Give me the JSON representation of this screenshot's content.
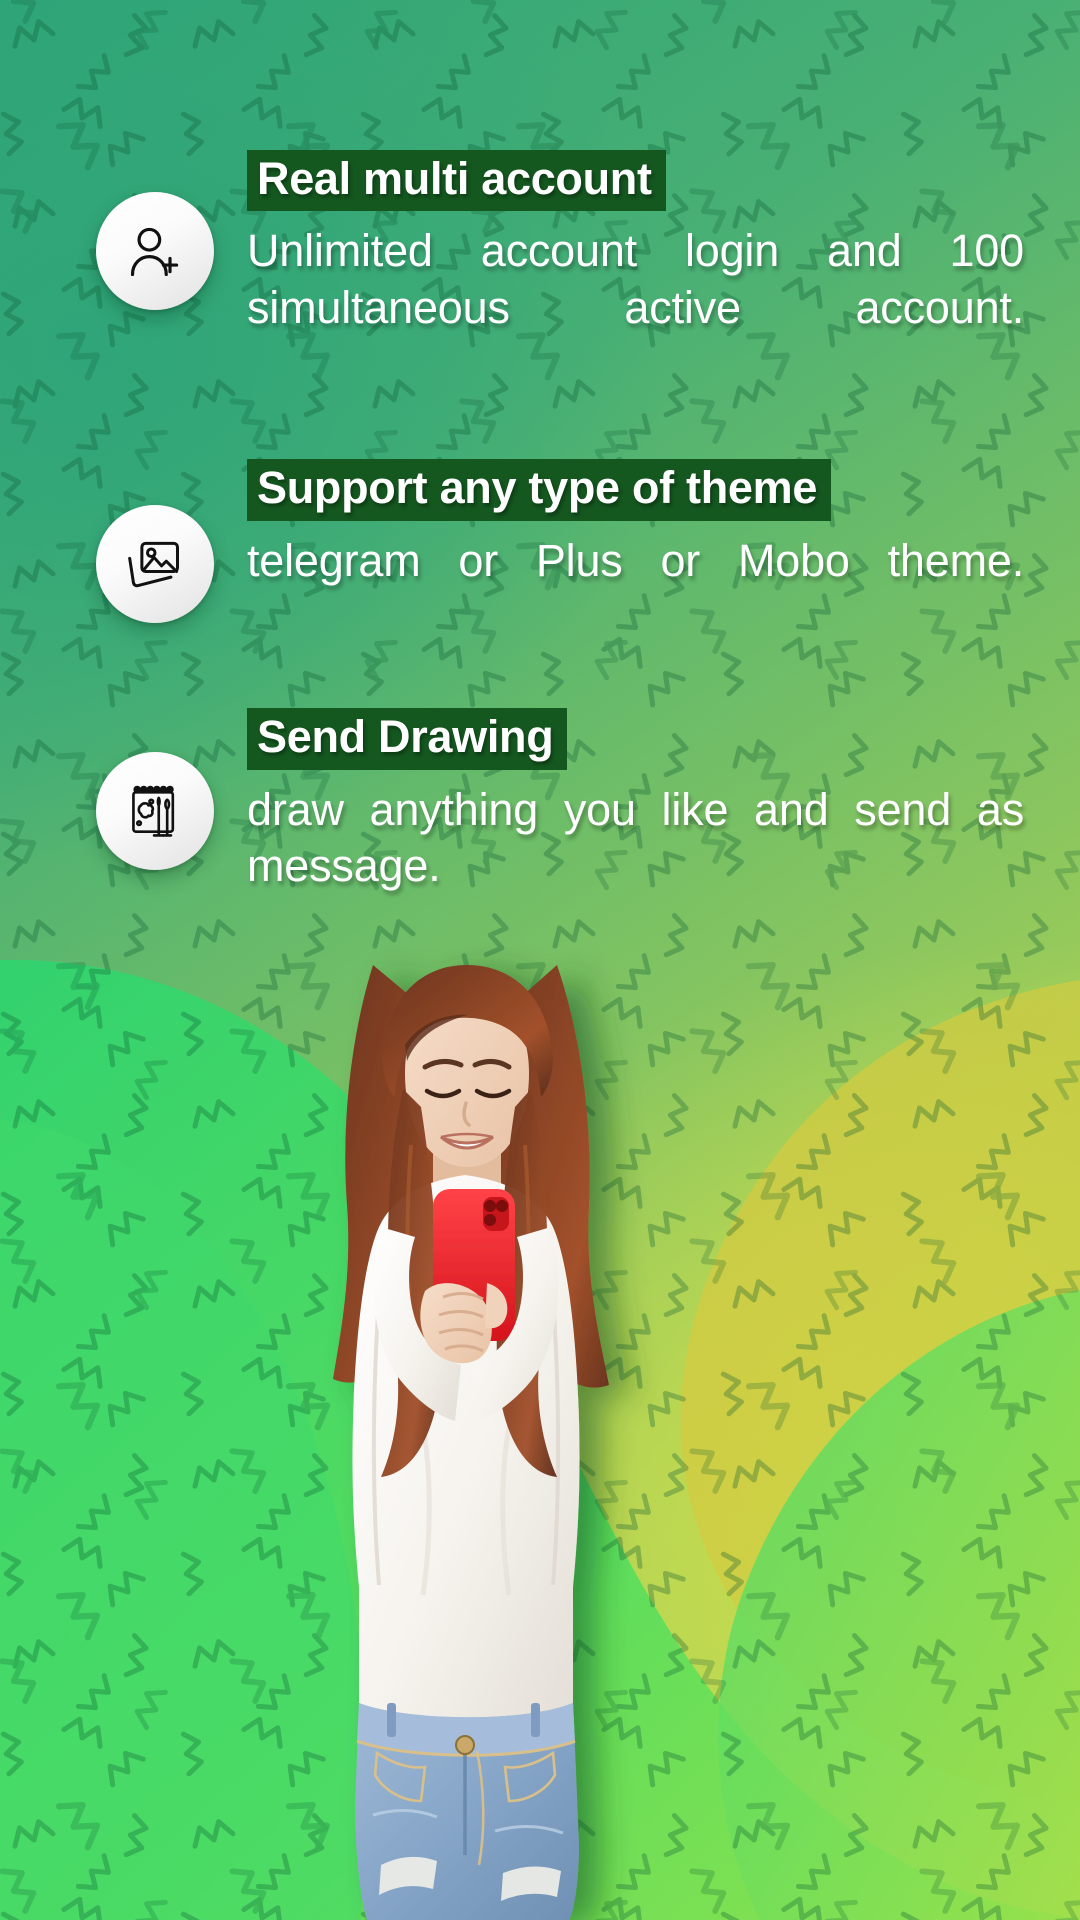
{
  "brand": {
    "heading_highlight_color": "#14571f",
    "text_color": "#ffffff",
    "bg_green_dark": "#2da477",
    "bg_green_light": "#c3d94e",
    "wave_green": "#3fd96b",
    "wave_olive": "#c9c344",
    "phone_color": "#f0272f"
  },
  "features": [
    {
      "icon": "add-user-icon",
      "heading": "Real multi account",
      "body": "Unlimited account login and 100 simultaneous active account."
    },
    {
      "icon": "image-gallery-icon",
      "heading": "Support any type of theme",
      "body": "telegram or Plus or Mobo theme."
    },
    {
      "icon": "sketchbook-drawing-icon",
      "heading": "Send Drawing",
      "body": "draw anything you like and send as message."
    }
  ],
  "illustration": {
    "name": "woman-holding-phone",
    "description": "Smiling woman with long brown hair in white long-sleeve top and ripped blue denim shorts holding a red smartphone"
  }
}
